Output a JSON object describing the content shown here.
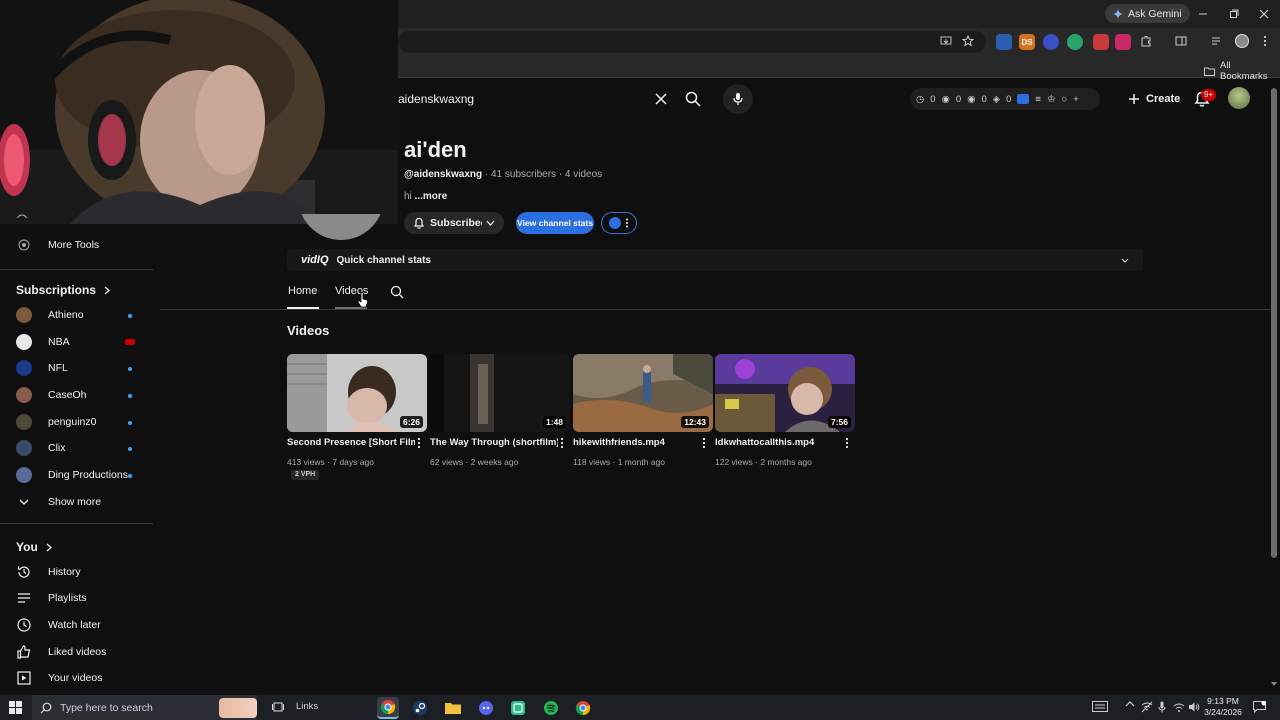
{
  "browser": {
    "gemini_label": "Ask Gemini",
    "bookmarks_label": "All Bookmarks",
    "omnibox_url": ""
  },
  "masthead": {
    "search_value": "aidenskwaxng",
    "vidiq_stats": [
      "0",
      "0",
      "0",
      "0"
    ],
    "create_label": "Create",
    "notif_badge": "9+"
  },
  "sidebar": {
    "more_tools": "More Tools",
    "subscriptions_header": "Subscriptions",
    "subscriptions": [
      {
        "name": "Athieno",
        "avatar_color": "#7a5a3a"
      },
      {
        "name": "NBA",
        "avatar_color": "#e8e8e8"
      },
      {
        "name": "NFL",
        "avatar_color": "#1a3a8a"
      },
      {
        "name": "CaseOh",
        "avatar_color": "#8a5a4a"
      },
      {
        "name": "penguinz0",
        "avatar_color": "#4a4a3a"
      },
      {
        "name": "Clix",
        "avatar_color": "#3a4a6a"
      },
      {
        "name": "Ding Productions",
        "avatar_color": "#5a6a9a"
      }
    ],
    "show_more": "Show more",
    "you_header": "You",
    "you_items": [
      {
        "label": "History",
        "icon": "history-icon"
      },
      {
        "label": "Playlists",
        "icon": "playlists-icon"
      },
      {
        "label": "Watch later",
        "icon": "watch-later-icon"
      },
      {
        "label": "Liked videos",
        "icon": "liked-icon"
      },
      {
        "label": "Your videos",
        "icon": "your-videos-icon"
      }
    ]
  },
  "channel": {
    "name": "ai'den",
    "handle": "@aidenskwaxng",
    "stats": "· 41 subscribers · 4 videos",
    "description": "hi",
    "more_label": "...more",
    "subscribed_label": "Subscribed",
    "view_stats_label": "View channel stats",
    "quick_stats_logo": "vidIQ",
    "quick_stats_label": "Quick channel stats"
  },
  "tabs": {
    "home": "Home",
    "videos": "Videos"
  },
  "videos_section": {
    "title": "Videos",
    "items": [
      {
        "title": "Second Presence [Short Film]",
        "duration": "6:26",
        "meta": "413 views · 7 days ago",
        "badge": "2 VPH"
      },
      {
        "title": "The Way Through (shortfilm)",
        "duration": "1:48",
        "meta": "62 views · 2 weeks ago"
      },
      {
        "title": "hikewithfriends.mp4",
        "duration": "12:43",
        "meta": "118 views · 1 month ago"
      },
      {
        "title": "Idkwhattocallthis.mp4",
        "duration": "7:56",
        "meta": "122 views · 2 months ago"
      }
    ]
  },
  "taskbar": {
    "search_placeholder": "Type here to search",
    "links_label": "Links",
    "time": "9:13 PM",
    "date": "3/24/2026"
  }
}
